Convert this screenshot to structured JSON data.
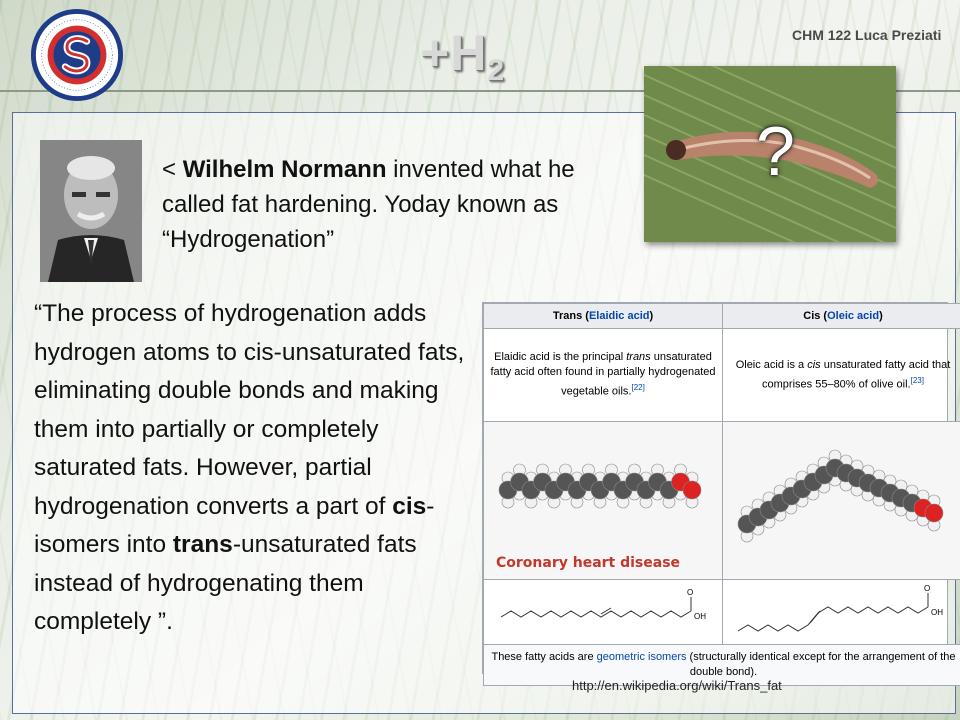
{
  "header": {
    "title_main": "+H",
    "title_sub": "2",
    "course": "CHM 122   Luca Preziati",
    "logo_text": "STARK STATE COLLEGE OF TECHNOLOGY 1960"
  },
  "intro": {
    "prefix": "< ",
    "name": "Wilhelm Normann",
    "rest": " invented what he called fat hardening. Yoday known as “Hydrogenation”"
  },
  "quote": {
    "part1": "“The process of hydrogenation adds hydrogen atoms to cis-unsaturated fats, eliminating double bonds and making them into partially or completely saturated fats. However, partial hydrogenation converts a part of ",
    "cis": "cis",
    "part2": "-isomers into ",
    "trans": "trans",
    "part3": "-unsaturated fats instead of hydrogenating them completely ”."
  },
  "caterpillar": {
    "mark": "?"
  },
  "wiki_table": {
    "col1_prefix": "Trans (",
    "col1_link": "Elaidic acid",
    "col1_suffix": ")",
    "col2_prefix": "Cis (",
    "col2_link": "Oleic acid",
    "col2_suffix": ")",
    "desc1_a": "Elaidic acid is the principal ",
    "desc1_em": "trans",
    "desc1_b": " unsaturated fatty acid often found in partially hydrogenated vegetable oils.",
    "desc1_ref": "[22]",
    "desc2_a": "Oleic acid is a ",
    "desc2_em": "cis",
    "desc2_b": " unsaturated fatty acid that comprises 55–80% of olive oil.",
    "desc2_ref": "[23]",
    "annotation": "Coronary heart disease",
    "foot_a": "These fatty acids are ",
    "foot_link": "geometric isomers",
    "foot_b": " (structurally identical except for the arrangement of the double bond).",
    "oh_label": "OH",
    "o_label": "O"
  },
  "source_url": "http://en.wikipedia.org/wiki/Trans_fat",
  "colors": {
    "accent_red": "#c0392b",
    "link_blue": "#0645ad",
    "logo_red": "#d32f2f",
    "logo_blue": "#1f3c88"
  }
}
